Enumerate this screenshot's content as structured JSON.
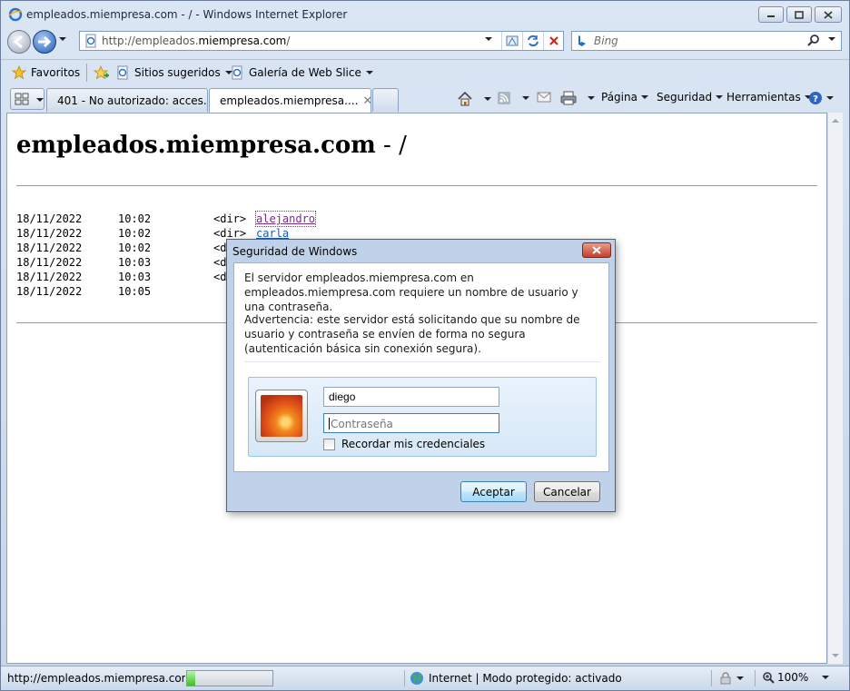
{
  "window": {
    "title": "empleados.miempresa.com - / - Windows Internet Explorer"
  },
  "address_bar": {
    "url_prefix": "http://empleados.",
    "url_domain": "miempresa.com",
    "url_suffix": "/"
  },
  "search": {
    "placeholder": "Bing"
  },
  "favorites_bar": {
    "favorites_label": "Favoritos",
    "suggested_sites": "Sitios sugeridos",
    "web_slice": "Galería de Web Slice"
  },
  "tabs": [
    {
      "label": "401 - No autorizado: acces..."
    },
    {
      "label": "empleados.miempresa...."
    }
  ],
  "command_bar": {
    "page": "Página",
    "security": "Seguridad",
    "tools": "Herramientas"
  },
  "page": {
    "heading_host": "empleados.miempresa.com",
    "heading_path": " - /",
    "listing": [
      {
        "date": "18/11/2022",
        "time": "10:02",
        "type": "<dir>",
        "name": "alejandro"
      },
      {
        "date": "18/11/2022",
        "time": "10:02",
        "type": "<dir>",
        "name": "carla"
      },
      {
        "date": "18/11/2022",
        "time": "10:02",
        "type": "<d",
        "name": ""
      },
      {
        "date": "18/11/2022",
        "time": "10:03",
        "type": "<d",
        "name": ""
      },
      {
        "date": "18/11/2022",
        "time": "10:03",
        "type": "<d",
        "name": ""
      },
      {
        "date": "18/11/2022",
        "time": "10:05",
        "type": "",
        "name": ""
      }
    ]
  },
  "dialog": {
    "title": "Seguridad de Windows",
    "message": "El servidor empleados.miempresa.com en empleados.miempresa.com requiere un nombre de usuario y una contraseña.",
    "warning": "Advertencia: este servidor está solicitando que su nombre de usuario y contraseña se envíen de forma no segura (autenticación básica sin conexión segura).",
    "username_value": "diego",
    "password_placeholder": "Contraseña",
    "remember_label": "Recordar mis credenciales",
    "remember_checked": false,
    "ok_label": "Aceptar",
    "cancel_label": "Cancelar"
  },
  "status_bar": {
    "url": "http://empleados.miempresa.com/a",
    "progress": 0.1,
    "zone": "Internet | Modo protegido: activado",
    "zoom": "100%"
  },
  "colors": {
    "link": "#1a5fb4",
    "visited_link": "#7a2a8a",
    "dialog_frame": "#c0d2ea",
    "close_button": "#c4412a"
  },
  "icons": [
    "ie-icon",
    "back-arrow-icon",
    "forward-arrow-icon",
    "page-icon",
    "compat-view-icon",
    "refresh-icon",
    "stop-icon",
    "bing-icon",
    "search-icon",
    "favorites-star-icon",
    "add-favorites-icon",
    "quick-tabs-icon",
    "home-icon",
    "feeds-icon",
    "mail-icon",
    "print-icon",
    "help-icon",
    "globe-icon",
    "user-picture-icon",
    "zoom-icon"
  ]
}
